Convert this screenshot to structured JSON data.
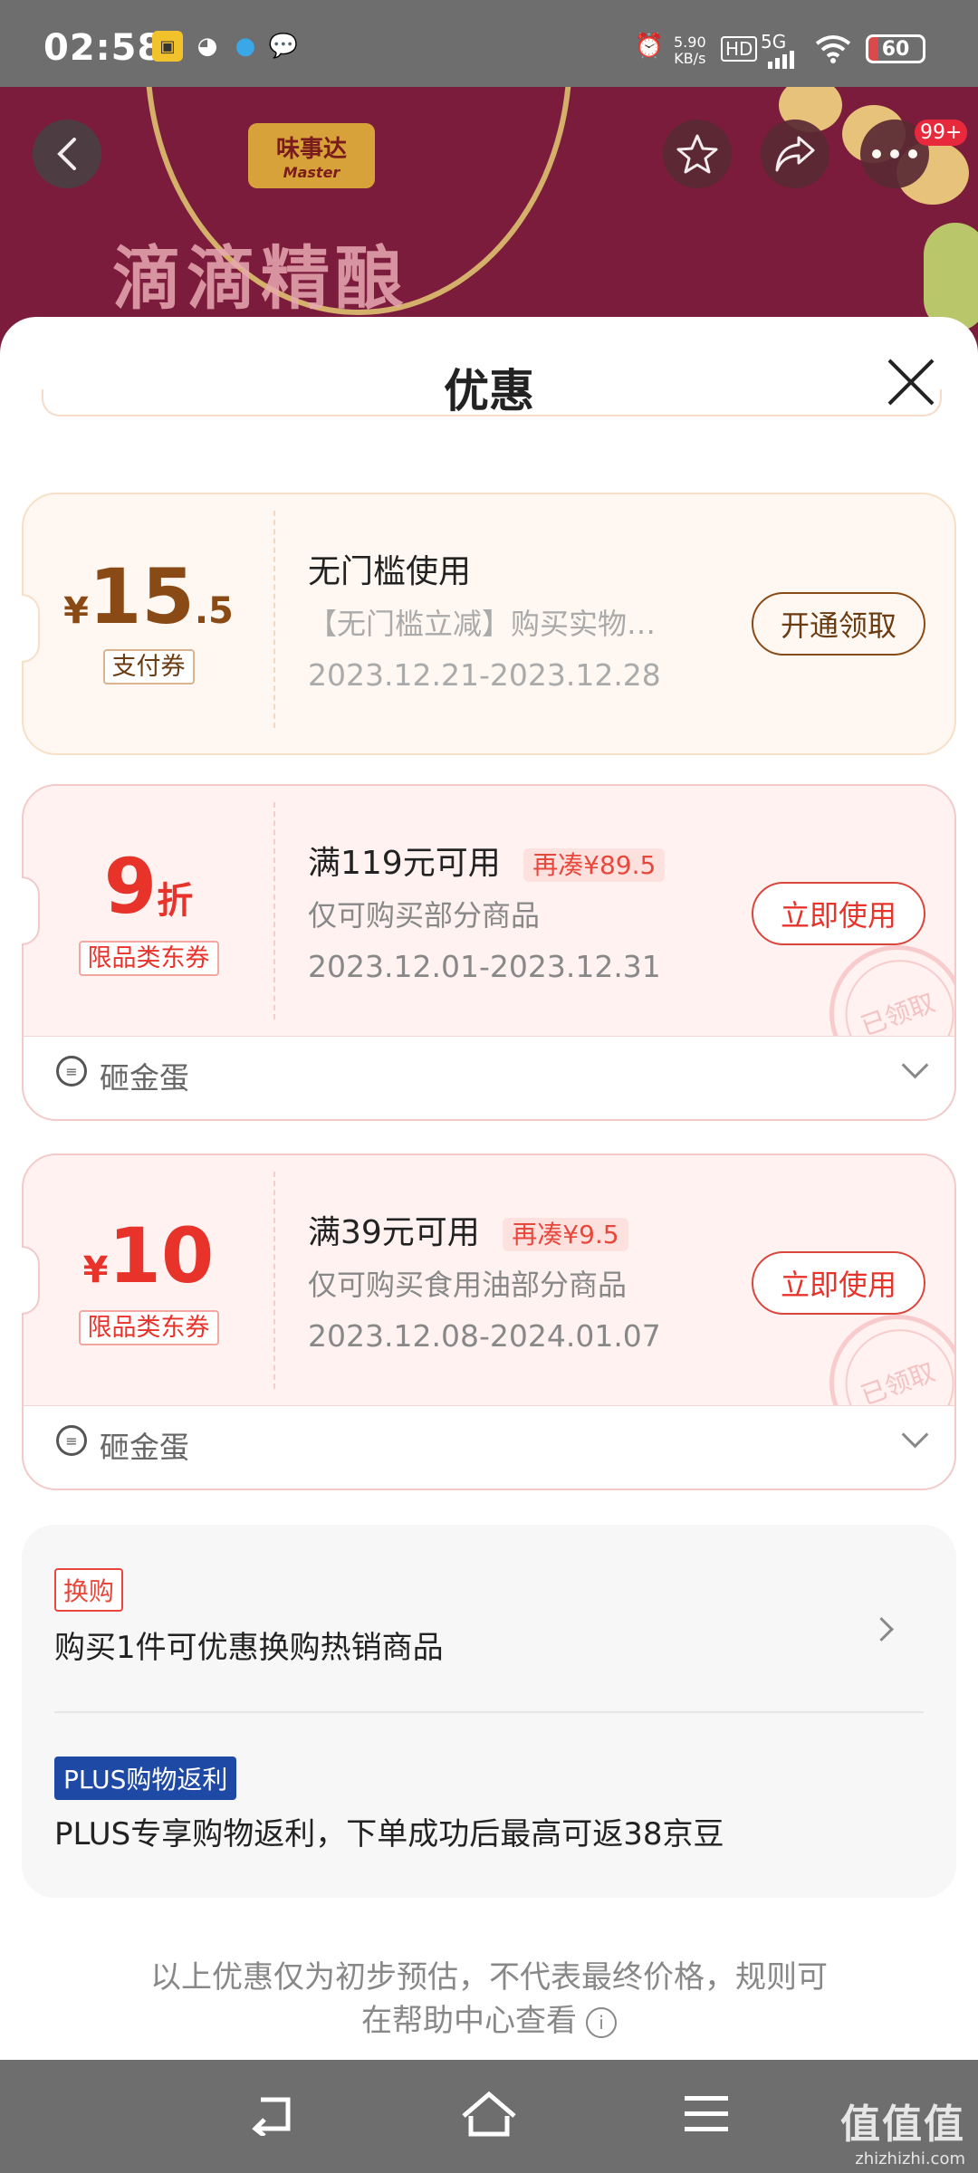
{
  "status_bar": {
    "time": "02:58",
    "net_speed_value": "5.90",
    "net_speed_unit": "KB/s",
    "hd": "HD",
    "signal": "5G",
    "battery": "60",
    "icons": [
      "app-notification-icon",
      "wechat-icon",
      "qq-icon",
      "message-icon",
      "alarm-icon",
      "wifi-icon"
    ]
  },
  "product_header": {
    "brand_logo": "味事达",
    "brand_logo_sub": "Master",
    "banner_title": "滴滴精酿",
    "more_badge": "99+",
    "icons": [
      "back-icon",
      "star-icon",
      "share-icon",
      "more-icon"
    ]
  },
  "sheet": {
    "title": "优惠"
  },
  "coupons": [
    {
      "yen": "¥",
      "amount_int": "15",
      "amount_dec": ".5",
      "type_tag": "支付券",
      "title": "无门槛使用",
      "desc": "【无门槛立减】购买实物…",
      "date_range": "2023.12.21-2023.12.28",
      "button": "开通领取"
    },
    {
      "discount": "9",
      "discount_unit": "折",
      "type_tag": "限品类东券",
      "title": "满119元可用",
      "extra_tag": "再凑¥89.5",
      "desc": "仅可购买部分商品",
      "date_range": "2023.12.01-2023.12.31",
      "button": "立即使用",
      "stamp": "已领取",
      "source": "砸金蛋"
    },
    {
      "yen": "¥",
      "amount_int": "10",
      "type_tag": "限品类东券",
      "title": "满39元可用",
      "extra_tag": "再凑¥9.5",
      "desc": "仅可购买食用油部分商品",
      "date_range": "2023.12.08-2024.01.07",
      "button": "立即使用",
      "stamp": "已领取",
      "source": "砸金蛋"
    }
  ],
  "offers": {
    "swap_tag": "换购",
    "swap_text": "购买1件可优惠换购热销商品",
    "plus_tag": "PLUS购物返利",
    "plus_text": "PLUS专享购物返利，下单成功后最高可返38京豆"
  },
  "disclaimer": {
    "line1": "以上优惠仅为初步预估，不代表最终价格，规则可",
    "line2": "在帮助中心查看"
  },
  "nav_bar": {
    "icons": [
      "back-nav-icon",
      "home-nav-icon",
      "menu-nav-icon"
    ]
  },
  "watermark": {
    "text": "值值值",
    "sub": "zhizhizhi.com"
  },
  "colors": {
    "accent_red": "#e8483c",
    "brown": "#8a4a16",
    "plus_blue": "#1e4aa5"
  }
}
